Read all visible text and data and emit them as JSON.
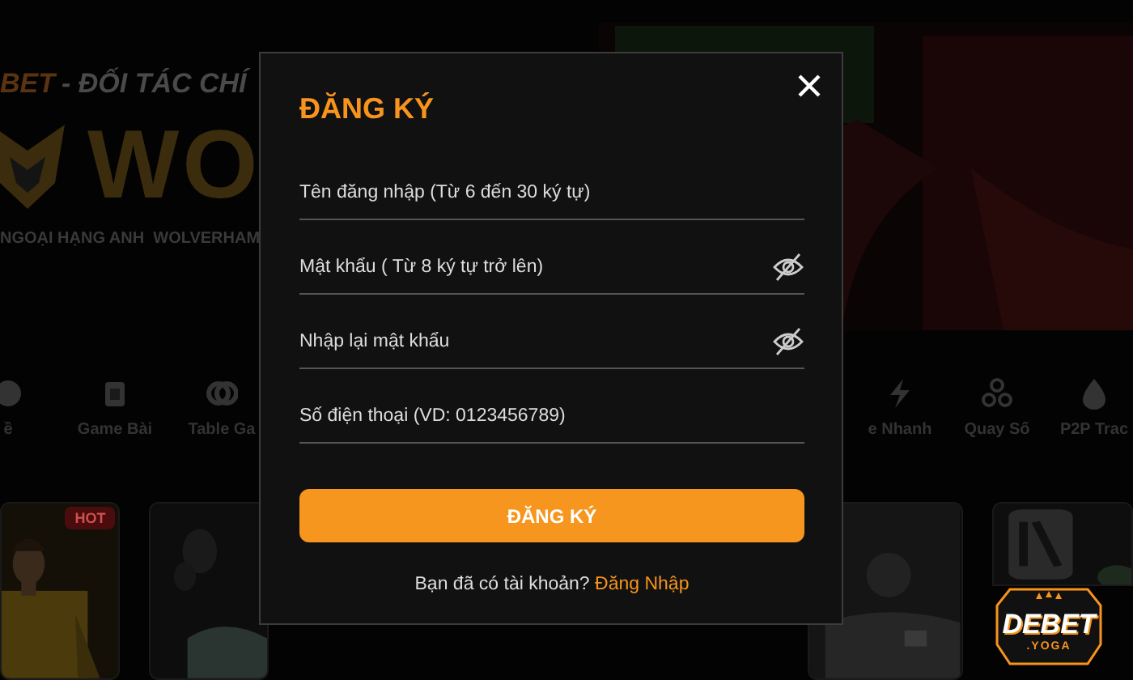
{
  "background": {
    "banner": {
      "brand": "BET",
      "tagline": "- ĐỐI TÁC CHÍ",
      "logo_text": "WO",
      "subtitle": "NGOẠI HẠNG ANH  WOLVERHAM"
    },
    "nav": [
      {
        "label": "ề",
        "kind": "ball"
      },
      {
        "label": "Game Bài",
        "kind": "cards"
      },
      {
        "label": "Table Ga",
        "kind": "chips"
      },
      {
        "label": "e Nhanh",
        "kind": "bolt"
      },
      {
        "label": "Quay Số",
        "kind": "balls"
      },
      {
        "label": "P2P Trac",
        "kind": "drop"
      }
    ],
    "hot_badge": "HOT"
  },
  "modal": {
    "title": "ĐĂNG KÝ",
    "fields": [
      {
        "placeholder": "Tên đăng nhập (Từ 6 đến 30 ký tự)",
        "kind": "text"
      },
      {
        "placeholder": "Mật khẩu ( Từ 8 ký tự trở lên)",
        "kind": "password"
      },
      {
        "placeholder": "Nhập lại mật khẩu",
        "kind": "password"
      },
      {
        "placeholder": "Số điện thoại (VD: 0123456789)",
        "kind": "phone"
      }
    ],
    "submit": "ĐĂNG KÝ",
    "footer_text": "Bạn đã có tài khoản?",
    "footer_link": "Đăng Nhập"
  },
  "site_logo": {
    "name": "DEBET",
    "suffix": ".YOGA"
  }
}
